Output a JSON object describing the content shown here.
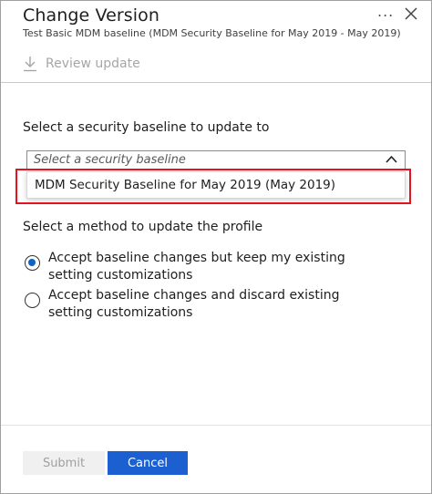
{
  "panel": {
    "title": "Change Version",
    "more_label": "...",
    "subtitle": "Test Basic MDM baseline (MDM Security Baseline for May 2019 - May 2019)"
  },
  "toolbar": {
    "review_label": "Review update",
    "review_icon": "download-arrow-icon"
  },
  "baseline_select": {
    "label": "Select a security baseline to update to",
    "placeholder": "Select a security baseline",
    "expanded": true,
    "options": [
      "MDM Security Baseline for May 2019 (May 2019)"
    ]
  },
  "method": {
    "label": "Select a method to update the profile",
    "options": [
      {
        "label": "Accept baseline changes but keep my existing setting customizations",
        "selected": true
      },
      {
        "label": "Accept baseline changes and discard existing setting customizations",
        "selected": false
      }
    ]
  },
  "footer": {
    "submit_label": "Submit",
    "cancel_label": "Cancel"
  },
  "colors": {
    "accent": "#1c5fd0",
    "highlight": "#e3131f",
    "radio_selected": "#0e63c8",
    "disabled": "#a0a0a0"
  }
}
